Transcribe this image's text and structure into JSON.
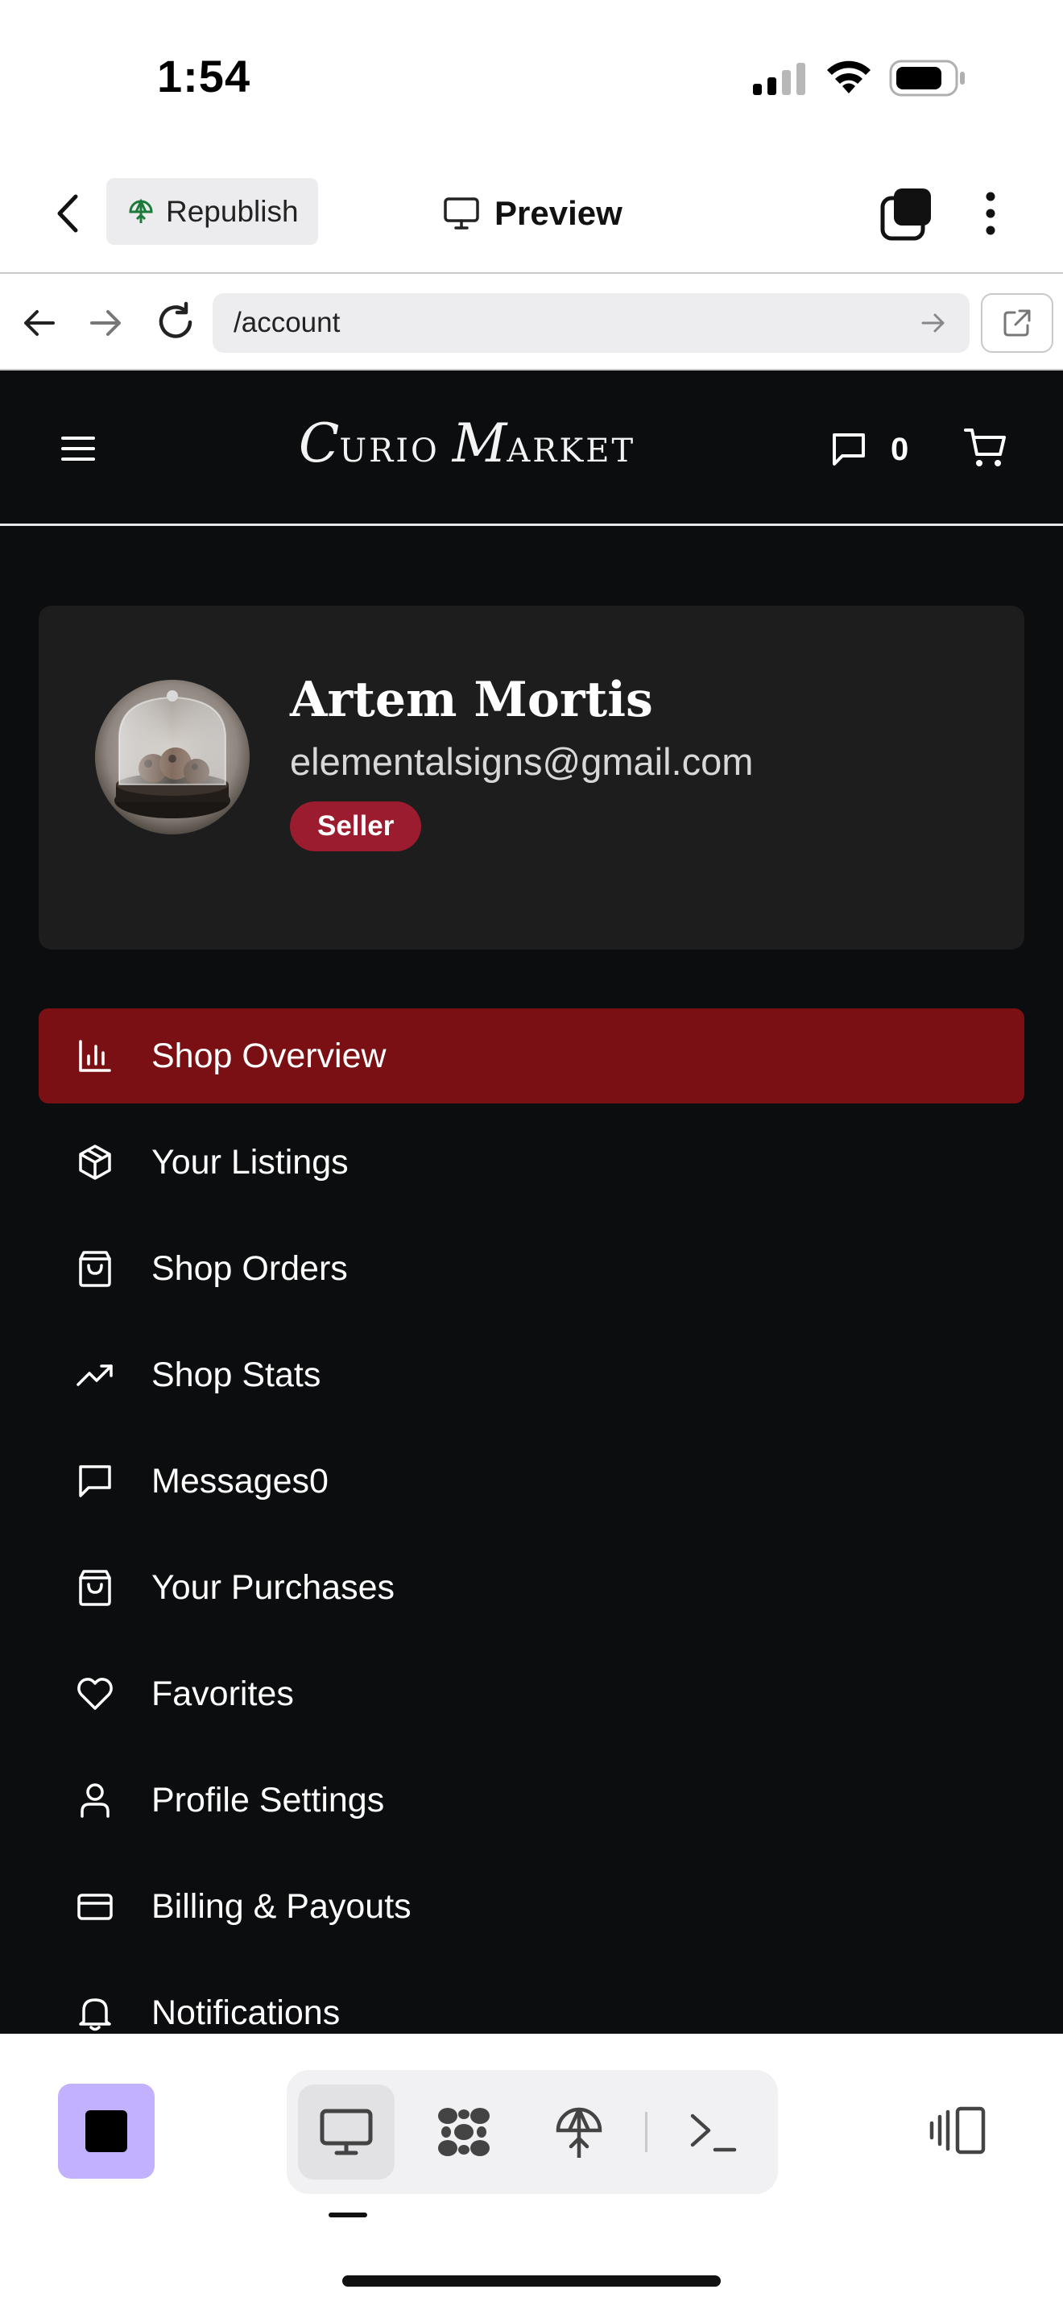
{
  "status_bar": {
    "time": "1:54"
  },
  "toolbar": {
    "republish_label": "Republish",
    "preview_label": "Preview"
  },
  "url_bar": {
    "url": "/account"
  },
  "site": {
    "logo_parts": [
      "C",
      "URIO",
      "M",
      "ARKET"
    ],
    "messages_count": "0"
  },
  "profile": {
    "name": "Artem Mortis",
    "email": "elementalsigns@gmail.com",
    "badge": "Seller"
  },
  "menu": {
    "items": [
      {
        "label": "Shop Overview",
        "icon": "bar-chart-icon",
        "active": true
      },
      {
        "label": "Your Listings",
        "icon": "package-icon"
      },
      {
        "label": "Shop Orders",
        "icon": "shopping-bag-icon"
      },
      {
        "label": "Shop Stats",
        "icon": "trending-up-icon"
      },
      {
        "label": "Messages0",
        "icon": "message-icon"
      },
      {
        "label": "Your Purchases",
        "icon": "shopping-bag-icon"
      },
      {
        "label": "Favorites",
        "icon": "heart-icon"
      },
      {
        "label": "Profile Settings",
        "icon": "user-icon"
      },
      {
        "label": "Billing & Payouts",
        "icon": "credit-card-icon"
      },
      {
        "label": "Notifications",
        "icon": "bell-icon"
      }
    ]
  },
  "colors": {
    "app_background": "#0c0d0e",
    "card_background": "#1d1d1e",
    "active_item": "#7a1014",
    "seller_badge": "#9b1c2e",
    "stop_button": "#c1b1ff"
  }
}
